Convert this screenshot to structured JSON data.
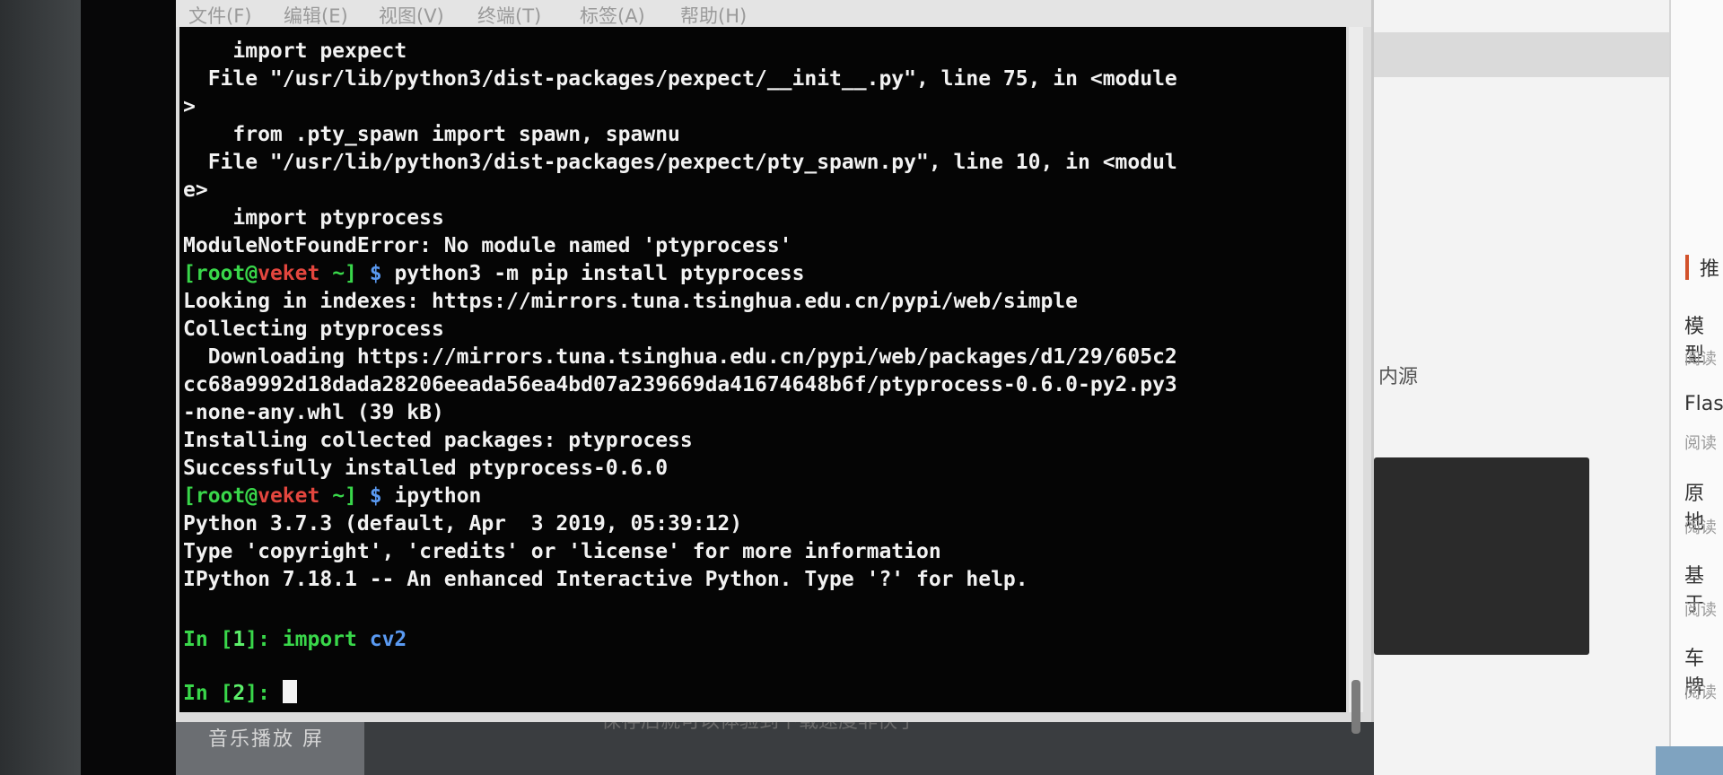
{
  "menu": [
    "文件(F)",
    "编辑(E)",
    "视图(V)",
    "终端(T)",
    "标签(A)",
    "帮助(H)"
  ],
  "terminal": {
    "lines": [
      "    import pexpect",
      "  File \"/usr/lib/python3/dist-packages/pexpect/__init__.py\", line 75, in <module",
      ">",
      "    from .pty_spawn import spawn, spawnu",
      "  File \"/usr/lib/python3/dist-packages/pexpect/pty_spawn.py\", line 10, in <modul",
      "e>",
      "    import ptyprocess",
      "ModuleNotFoundError: No module named 'ptyprocess'"
    ],
    "prompt1": {
      "open": "[",
      "user": "root",
      "at": "@",
      "host": "veket",
      "dir": " ~]",
      "dollar": " $ ",
      "cmd": "python3 -m pip install ptyprocess"
    },
    "pip_lines": [
      "Looking in indexes: https://mirrors.tuna.tsinghua.edu.cn/pypi/web/simple",
      "Collecting ptyprocess",
      "  Downloading https://mirrors.tuna.tsinghua.edu.cn/pypi/web/packages/d1/29/605c2",
      "cc68a9992d18dada28206eeada56ea4bd07a239669da41674648b6f/ptyprocess-0.6.0-py2.py3",
      "-none-any.whl (39 kB)",
      "Installing collected packages: ptyprocess",
      "Successfully installed ptyprocess-0.6.0"
    ],
    "prompt2": {
      "open": "[",
      "user": "root",
      "at": "@",
      "host": "veket",
      "dir": " ~]",
      "dollar": " $ ",
      "cmd": "ipython"
    },
    "ipython_lines": [
      "Python 3.7.3 (default, Apr  3 2019, 05:39:12)",
      "Type 'copyright', 'credits' or 'license' for more information",
      "IPython 7.18.1 -- An enhanced Interactive Python. Type '?' for help."
    ],
    "in1": {
      "prefix": "In [",
      "num": "1",
      "suffix": "]: ",
      "kw": "import",
      "mod": " cv2"
    },
    "in2": {
      "prefix": "In [",
      "num": "2",
      "suffix": "]: "
    }
  },
  "background": {
    "taskbar_label": "音乐播放    屏",
    "sidebar_heading": "推",
    "items": [
      "模型",
      "Flas",
      "原地",
      "基于",
      "车牌"
    ],
    "read_label": "阅读",
    "partial_text": "内源",
    "bottom_text": "保存后就可以体验到下载速度非快了"
  }
}
